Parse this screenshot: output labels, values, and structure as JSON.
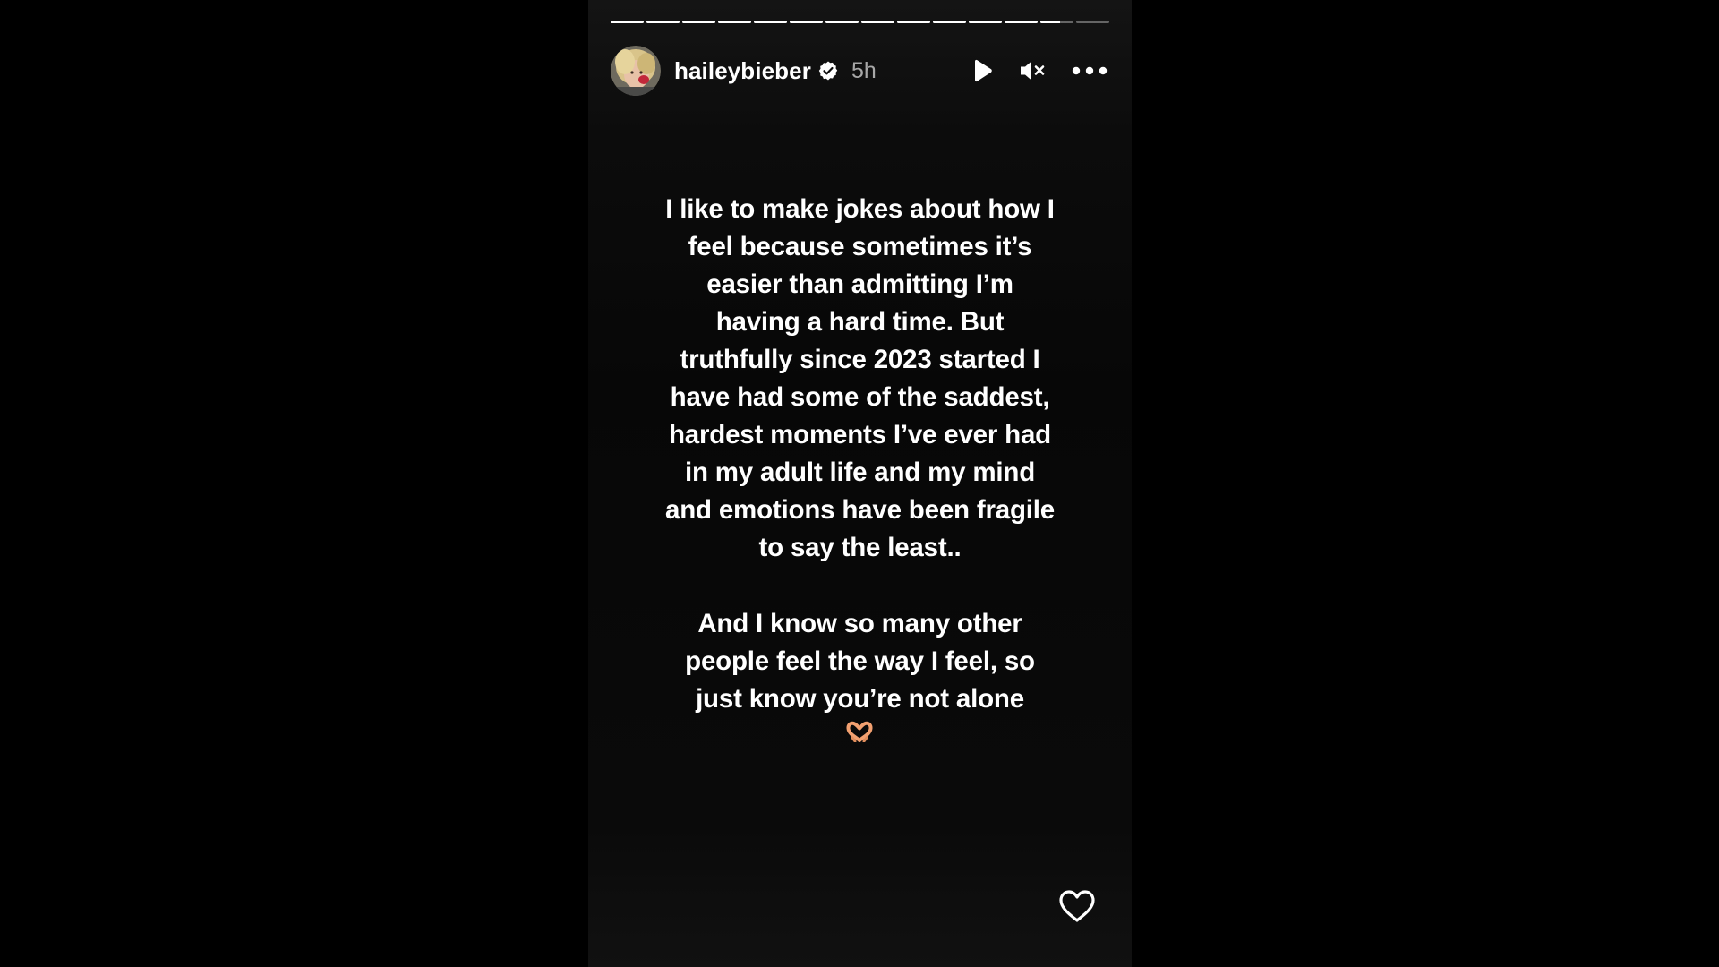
{
  "story": {
    "progress": {
      "segments": 14,
      "completed": 12,
      "current_fraction": 0.6
    },
    "header": {
      "username": "haileybieber",
      "time": "5h",
      "verified": true
    },
    "controls": {
      "play_icon": "play-icon",
      "mute_icon": "muted-speaker-icon",
      "more_icon": "more-options-icon"
    },
    "text": {
      "paragraph1": "I like to make jokes about how I\nfeel because sometimes it’s\neasier than admitting I’m\nhaving a hard time. But\ntruthfully since 2023 started I\nhave had some of the saddest,\nhardest moments I’ve ever had\nin my adult life and my mind\nand emotions have been fragile\nto say the least..",
      "paragraph2": "And I know so many other\npeople feel the way I feel, so\njust know you’re not alone",
      "emoji": "heart-hands-emoji"
    },
    "footer": {
      "like_icon": "heart-outline-icon"
    }
  },
  "colors": {
    "background": "#000000",
    "text": "#ffffff",
    "muted_text": "#a8a8a8",
    "verified_badge": "#ffffff",
    "emoji": "#f2a070"
  }
}
